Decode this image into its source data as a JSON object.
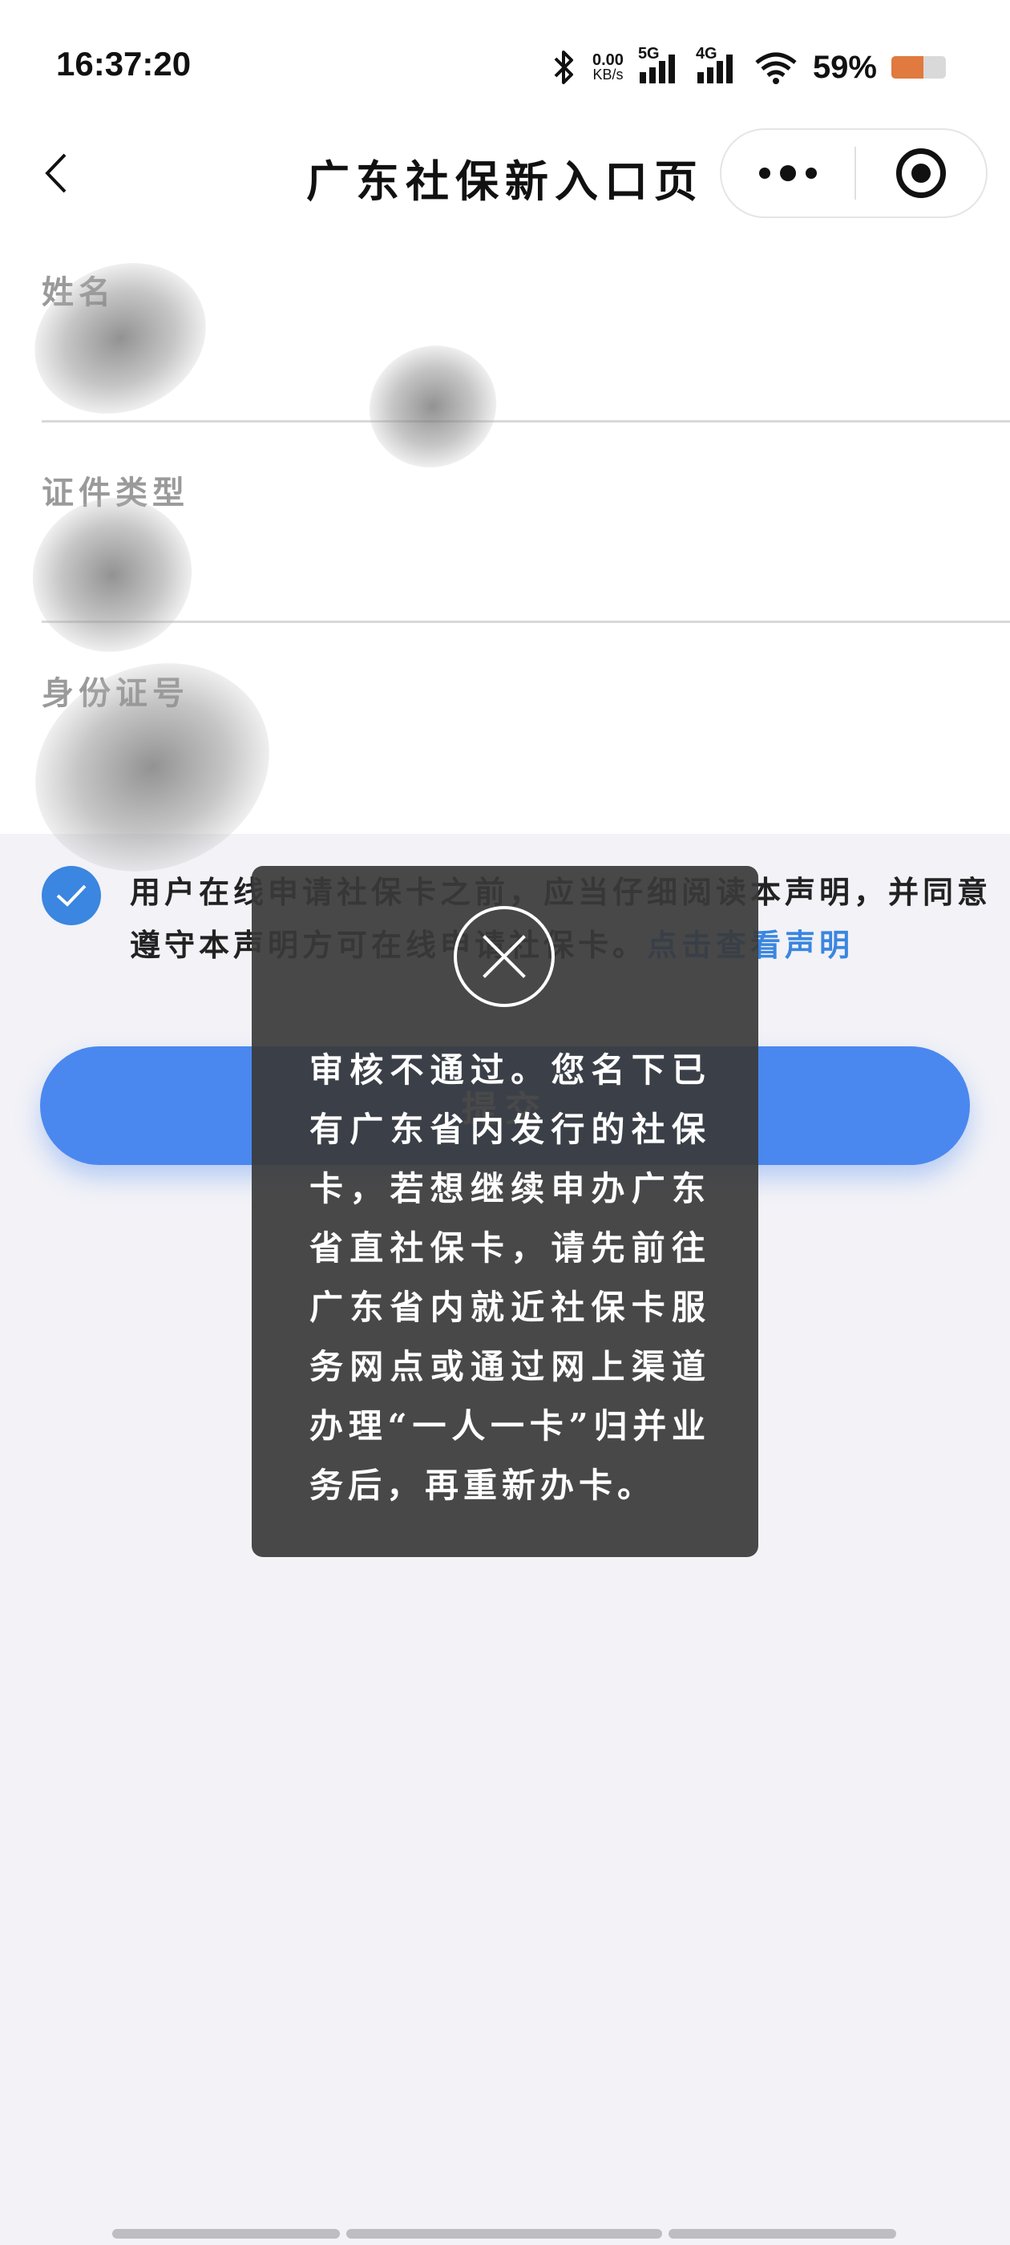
{
  "status_bar": {
    "time": "16:37:20",
    "net_speed_value": "0.00",
    "net_speed_unit": "KB/s",
    "signal1_label": "5G",
    "signal2_label": "4G",
    "battery_pct": "59%",
    "battery_level": 0.59,
    "icons": [
      "bluetooth-icon",
      "signal-icon",
      "wifi-icon",
      "battery-icon"
    ]
  },
  "nav": {
    "title": "广东社保新入口页",
    "back_icon": "chevron-left-icon",
    "more_icon": "more-dots-icon",
    "close_icon": "target-close-icon"
  },
  "form": {
    "fields": [
      {
        "label": "姓名"
      },
      {
        "label": "证件类型"
      },
      {
        "label": "身份证号"
      }
    ]
  },
  "agreement": {
    "checked": true,
    "text": "用户在线申请社保卡之前，应当仔细阅读本声明，并同意遵守本声明方可在线申请社保卡。",
    "link": "点击查看声明"
  },
  "submit": {
    "label": "提交"
  },
  "toast": {
    "message": "审核不通过。您名下已有广东省内发行的社保卡，若想继续申办广东省直社保卡，请先前往广东省内就近社保卡服务网点或通过网上渠道办理“一人一卡”归并业务后，再重新办卡。",
    "close_icon": "close-circle-icon"
  },
  "colors": {
    "accent": "#4a88ef",
    "link": "#3a86e0",
    "toast_bg": "#3a3a3a",
    "battery": "#e07a3e"
  }
}
